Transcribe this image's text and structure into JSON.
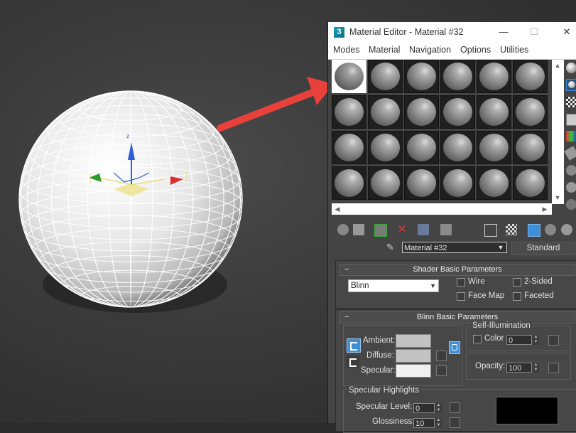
{
  "window": {
    "title": "Material Editor - Material #32",
    "minimize_glyph": "—",
    "maximize_glyph": "☐",
    "close_glyph": "✕"
  },
  "menu": {
    "items": [
      "Modes",
      "Material",
      "Navigation",
      "Options",
      "Utilities"
    ]
  },
  "toolbar": {
    "material_name": "Material #32",
    "material_type": "Standard"
  },
  "shader_rollout": {
    "title": "Shader Basic Parameters",
    "shader": "Blinn",
    "wire": "Wire",
    "two_sided": "2-Sided",
    "face_map": "Face Map",
    "faceted": "Faceted"
  },
  "blinn_rollout": {
    "title": "Blinn Basic Parameters",
    "ambient": "Ambient:",
    "diffuse": "Diffuse:",
    "specular": "Specular:",
    "self_illum_title": "Self-Illumination",
    "color_label": "Color",
    "color_value": "0",
    "opacity_label": "Opacity:",
    "opacity_value": "100",
    "spec_highlights_title": "Specular Highlights",
    "spec_level_label": "Specular Level:",
    "spec_level_value": "0",
    "glossiness_label": "Glossiness:",
    "glossiness_value": "10"
  },
  "colors": {
    "arrow": "#e8413b",
    "accent": "#3c8fd8",
    "ambient_swatch": "#c2c2c2",
    "diffuse_swatch": "#c2c2c2",
    "specular_swatch": "#f0f0f0"
  },
  "slots": {
    "count": 24,
    "active_index": 0
  }
}
